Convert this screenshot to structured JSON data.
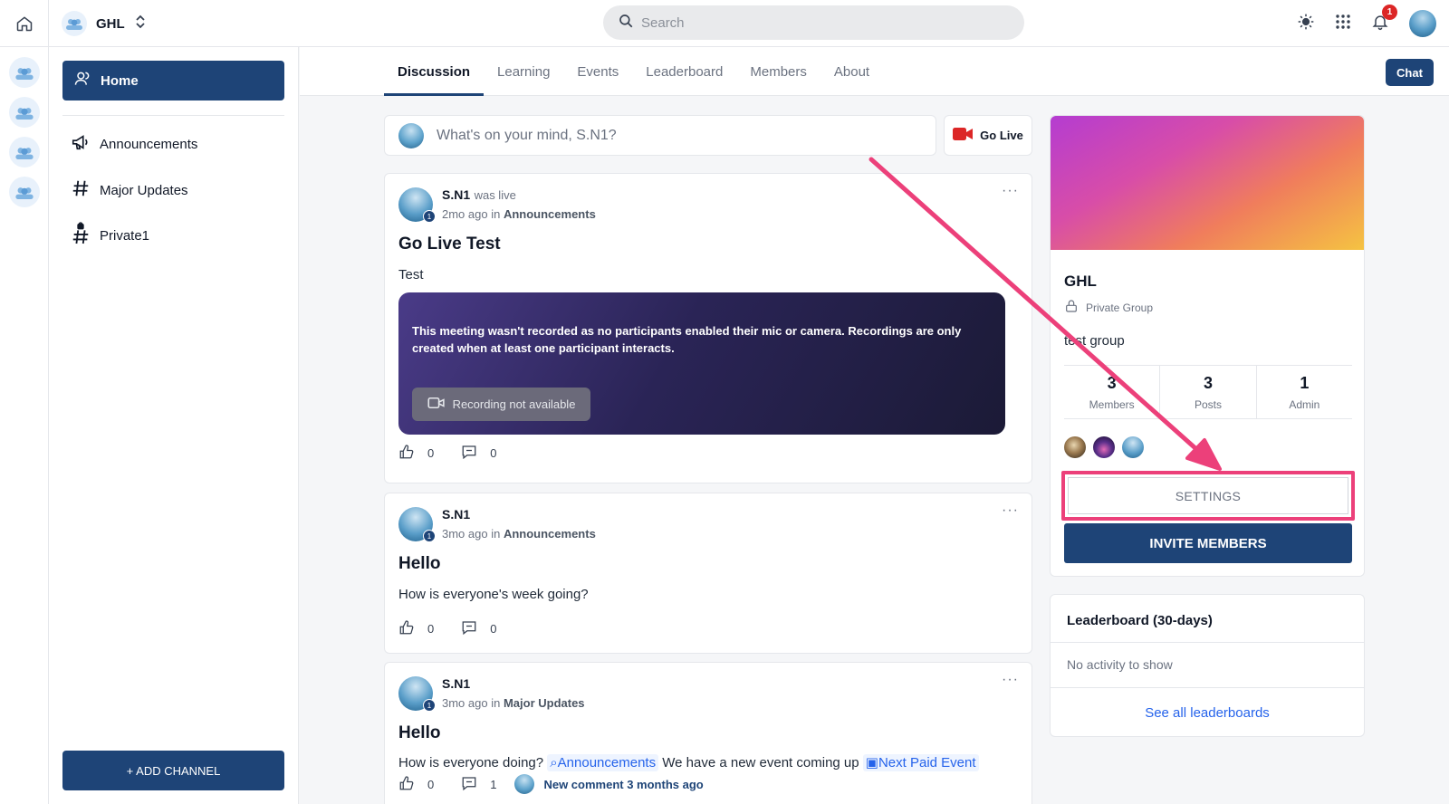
{
  "topbar": {
    "group_name": "GHL",
    "search_placeholder": "Search",
    "notification_count": "1"
  },
  "sidebar": {
    "home_label": "Home",
    "channels": [
      {
        "label": "Announcements",
        "icon": "megaphone-icon"
      },
      {
        "label": "Major Updates",
        "icon": "hash-icon"
      },
      {
        "label": "Private1",
        "icon": "locked-hash-icon"
      }
    ],
    "add_channel_label": "+ ADD CHANNEL"
  },
  "tabs": [
    "Discussion",
    "Learning",
    "Events",
    "Leaderboard",
    "Members",
    "About"
  ],
  "chat_label": "Chat",
  "composer": {
    "placeholder": "What's on your mind, S.N1?",
    "golive_label": "Go Live"
  },
  "posts": [
    {
      "author": "S.N1",
      "status": "was live",
      "time": "2mo ago",
      "in_label": "in",
      "channel": "Announcements",
      "title": "Go Live Test",
      "body": "Test",
      "meeting_message": "This meeting wasn't recorded as no participants enabled their mic or camera. Recordings are only created when at least one participant interacts.",
      "recording_label": "Recording not available",
      "likes": "0",
      "comments": "0"
    },
    {
      "author": "S.N1",
      "time": "3mo ago",
      "in_label": "in",
      "channel": "Announcements",
      "title": "Hello",
      "body": "How is everyone's week going?",
      "likes": "0",
      "comments": "0"
    },
    {
      "author": "S.N1",
      "time": "3mo ago",
      "in_label": "in",
      "channel": "Major Updates",
      "title": "Hello",
      "body_start": "How is everyone doing?",
      "mention_channel": "Announcements",
      "body_middle": "We have a new event coming up",
      "mention_event": "Next Paid Event",
      "likes": "0",
      "comments": "1",
      "new_comment": "New comment 3 months ago"
    }
  ],
  "level_badge": "1",
  "group_card": {
    "name": "GHL",
    "privacy": "Private Group",
    "description": "test group",
    "stats": [
      {
        "value": "3",
        "label": "Members"
      },
      {
        "value": "3",
        "label": "Posts"
      },
      {
        "value": "1",
        "label": "Admin"
      }
    ],
    "settings_label": "SETTINGS",
    "invite_label": "INVITE MEMBERS"
  },
  "leaderboard": {
    "title": "Leaderboard (30-days)",
    "empty": "No activity to show",
    "link": "See all leaderboards"
  },
  "colors": {
    "primary": "#1e4477",
    "annotation": "#ec407a",
    "link": "#2563eb"
  }
}
